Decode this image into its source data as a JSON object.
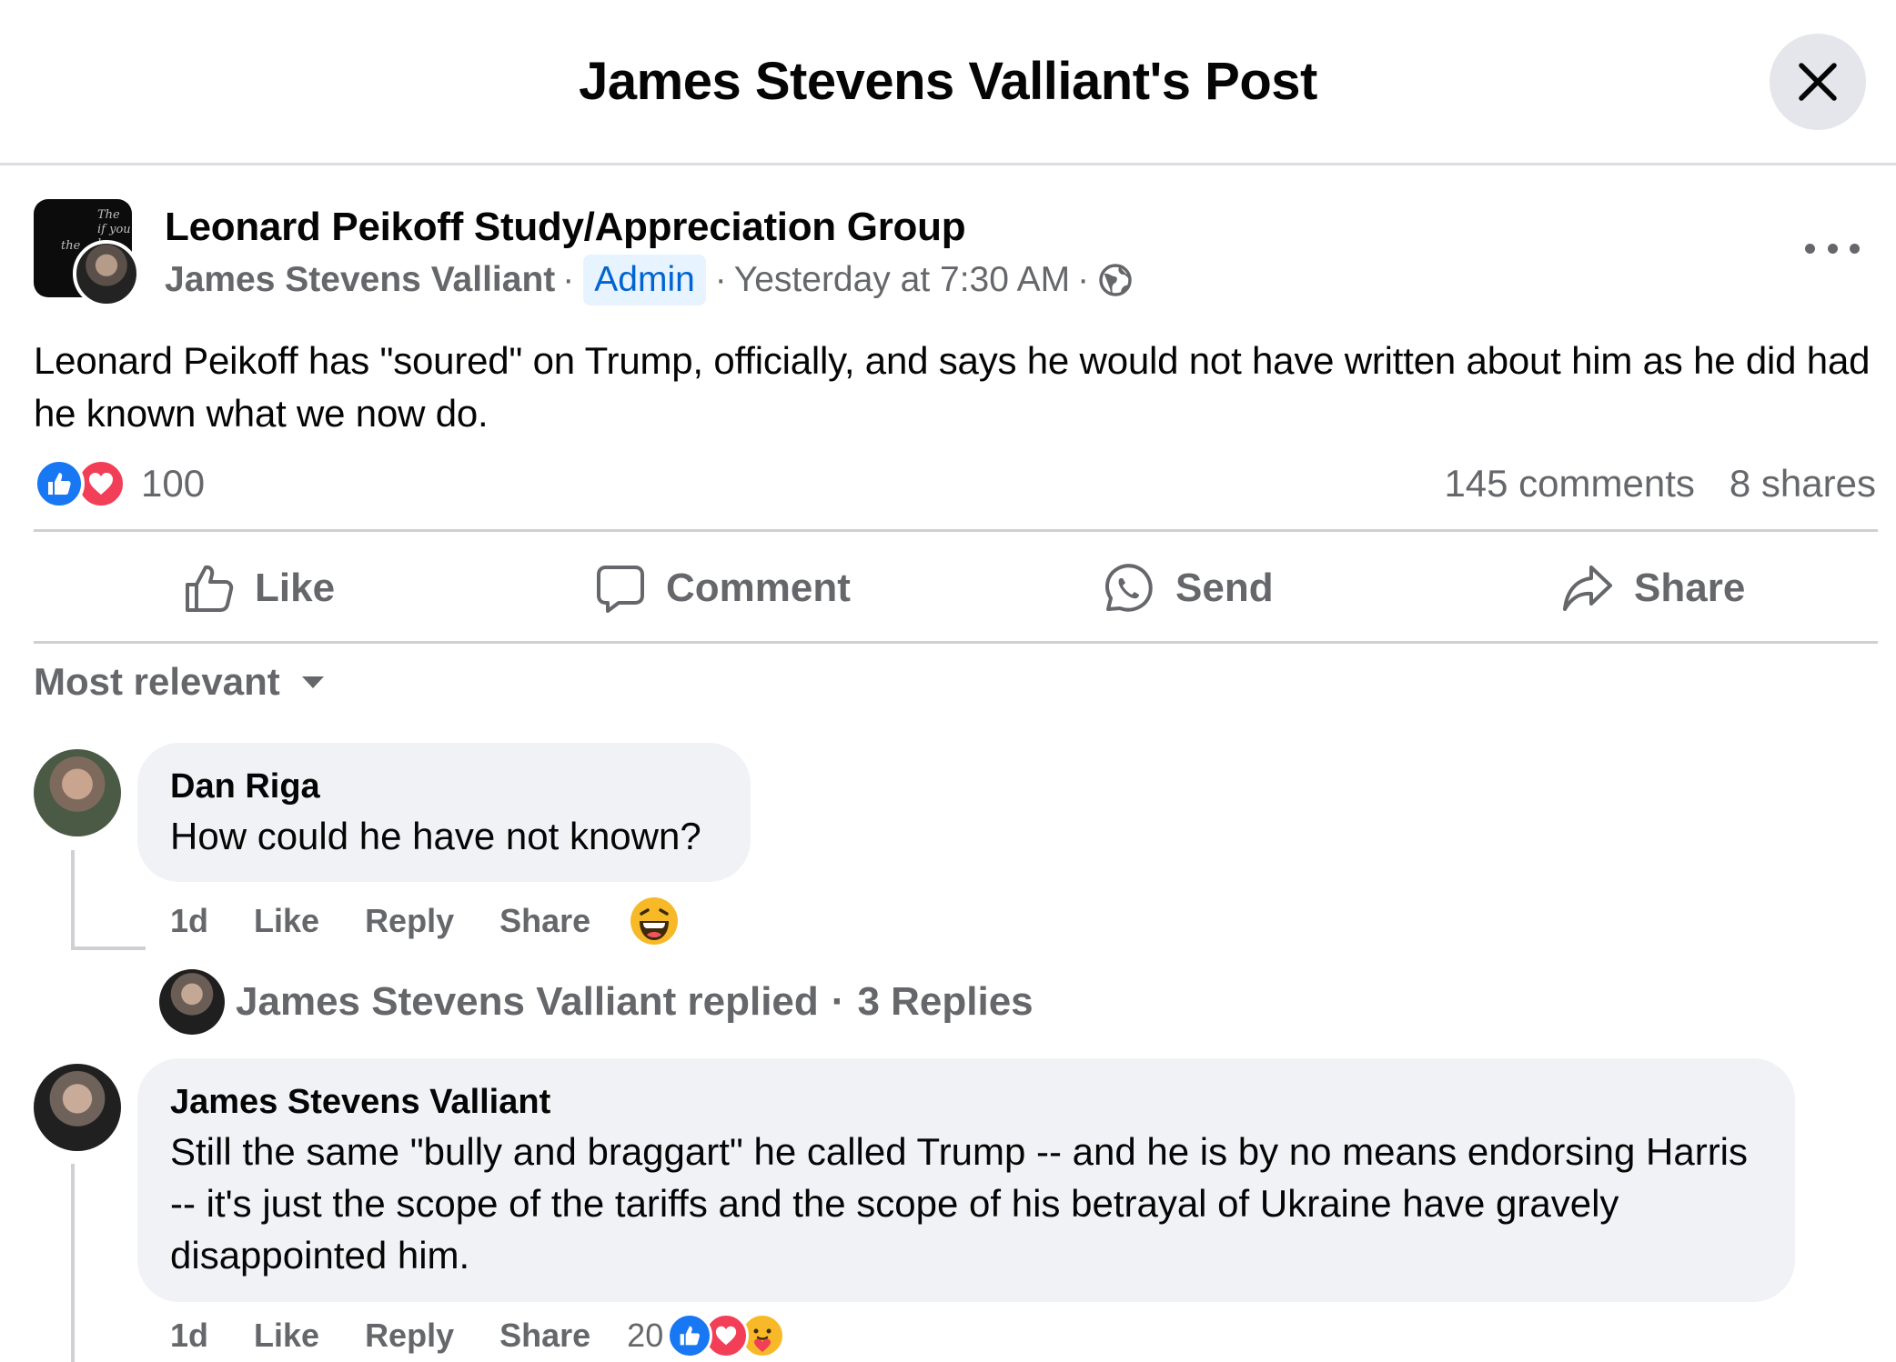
{
  "header": {
    "title": "James Stevens Valliant's Post"
  },
  "post": {
    "group_avatar_text": "The if you le the",
    "group_name": "Leonard Peikoff Study/Appreciation Group",
    "author": "James Stevens Valliant",
    "badge": "Admin",
    "time": "Yesterday at 7:30 AM",
    "separator": "·",
    "text": "Leonard Peikoff has \"soured\" on Trump, officially, and says he would not have written about him as he did had he known what we now do.",
    "reaction_count": "100",
    "comments_count": "145 comments",
    "shares_count": "8 shares",
    "icons": [
      "like-icon",
      "love-icon",
      "globe-icon",
      "more-icon"
    ]
  },
  "actions": {
    "like": "Like",
    "comment": "Comment",
    "send": "Send",
    "share": "Share"
  },
  "sort": {
    "label": "Most relevant"
  },
  "comments": [
    {
      "name": "Dan Riga",
      "text": "How could he have not known?",
      "time": "1d",
      "like": "Like",
      "reply": "Reply",
      "share": "Share",
      "reaction": "laughing-emoji"
    },
    {
      "name": "James Stevens Valliant",
      "text": "Still the same \"bully and braggart\" he called Trump -- and he is by no means endorsing Harris -- it's just the scope of the tariffs and the scope of his betrayal of Ukraine have gravely disappointed him.",
      "time": "1d",
      "like": "Like",
      "reply": "Reply",
      "share": "Share",
      "reaction_count": "20"
    }
  ],
  "replied": {
    "text": "James Stevens Valliant replied",
    "separator": "·",
    "replies": "3 Replies"
  },
  "colors": {
    "accent": "#1877f2",
    "love": "#f33e58",
    "secondary_text": "#65676b",
    "bubble": "#f0f2f5",
    "admin_bg": "#e7f3ff"
  }
}
